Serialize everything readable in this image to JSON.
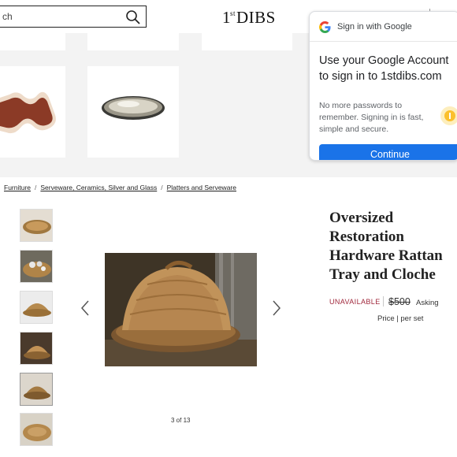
{
  "header": {
    "search_text": "ch",
    "logo_main_1": "1",
    "logo_sup": "st",
    "logo_main_2": "DIBS"
  },
  "google_popup": {
    "title": "Sign in with Google",
    "heading": "Use your Google Account to sign in to 1stdibs.com",
    "body": "No more passwords to remember. Signing in is fast, simple and secure.",
    "button": "Continue"
  },
  "breadcrumb": {
    "items": [
      "Furniture",
      "Serveware, Ceramics, Silver and Glass",
      "Platters and Serveware"
    ],
    "separator": "/"
  },
  "gallery": {
    "counter": "3 of 13",
    "thumbnail_count": 6,
    "active_thumbnail": 5
  },
  "product": {
    "title": "Oversized Restoration Hardware Rattan Tray and Cloche",
    "status": "UNAVAILABLE",
    "price": "$500",
    "asking_label": "Asking",
    "price_unit": "Price | per set"
  },
  "colors": {
    "google_blue": "#1a73e8",
    "unavailable_red": "#a0283c",
    "reco_background": "#f3f3f3"
  }
}
